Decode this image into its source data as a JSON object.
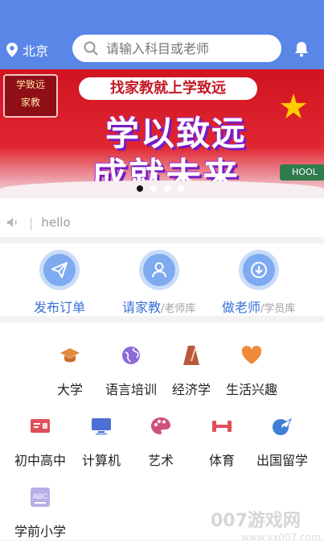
{
  "header": {
    "location": "北京",
    "search_placeholder": "请输入科目或老师"
  },
  "banner": {
    "logo_line1": "学致远",
    "logo_line2": "家教",
    "tagline": "找家教就上学致远",
    "headline1": "学以致远",
    "headline2": "成就未来",
    "sign": "HOOL",
    "slides": 4,
    "active_slide": 1
  },
  "notice": {
    "text": "hello"
  },
  "quick": [
    {
      "label": "发布订单",
      "sub": ""
    },
    {
      "label": "请家教",
      "sub": "/老师库"
    },
    {
      "label": "做老师",
      "sub": "/学员库"
    }
  ],
  "categories": [
    {
      "label": "大学",
      "icon": "graduation-cap-icon",
      "color": "#e08a3c"
    },
    {
      "label": "语言培训",
      "icon": "globe-icon",
      "color": "#8c6ad8"
    },
    {
      "label": "经济学",
      "icon": "metronome-icon",
      "color": "#b85a3a"
    },
    {
      "label": "生活兴趣",
      "icon": "heart-icon",
      "color": "#f08a3a"
    },
    {
      "label": "初中高中",
      "icon": "blackboard-icon",
      "color": "#e0505a"
    },
    {
      "label": "计算机",
      "icon": "monitor-icon",
      "color": "#4d6fd6"
    },
    {
      "label": "艺术",
      "icon": "palette-icon",
      "color": "#d0507a"
    },
    {
      "label": "体育",
      "icon": "dumbbell-icon",
      "color": "#e0505a"
    },
    {
      "label": "出国留学",
      "icon": "plane-globe-icon",
      "color": "#3f7fd6"
    },
    {
      "label": "学前小学",
      "icon": "abc-book-icon",
      "color": "#9a8ad8"
    }
  ],
  "watermark": {
    "text": "007游戏网",
    "url": "www.yx007.com"
  },
  "colors": {
    "primary": "#5a86e8",
    "accent_blue": "#3b6fd8"
  }
}
